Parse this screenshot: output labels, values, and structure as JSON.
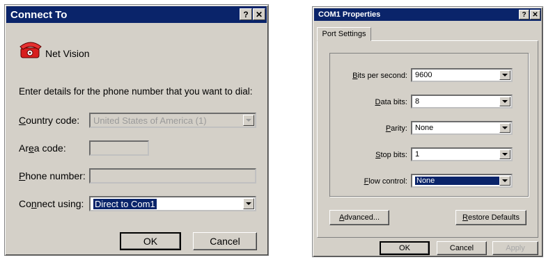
{
  "connect_dialog": {
    "title": "Connect To",
    "help_btn": "?",
    "close_btn": "✕",
    "connection_name": "Net Vision",
    "instruction": "Enter details for the phone number that you want to dial:",
    "country_label_ul": "C",
    "country_label_rest": "ountry code:",
    "country_value": "United States of America (1)",
    "area_label_1": "Ar",
    "area_label_ul": "e",
    "area_label_2": "a code:",
    "area_value": "",
    "phone_label_ul": "P",
    "phone_label_rest": "hone number:",
    "phone_value": "",
    "connect_label_1": "Co",
    "connect_label_ul": "n",
    "connect_label_2": "nect using:",
    "connect_value": "Direct to Com1",
    "ok": "OK",
    "cancel": "Cancel"
  },
  "com_dialog": {
    "title": "COM1 Properties",
    "help_btn": "?",
    "close_btn": "✕",
    "tab": "Port Settings",
    "fields": [
      {
        "pre": "",
        "ul": "B",
        "post": "its per second:",
        "value": "9600"
      },
      {
        "pre": "",
        "ul": "D",
        "post": "ata bits:",
        "value": "8"
      },
      {
        "pre": "",
        "ul": "P",
        "post": "arity:",
        "value": "None"
      },
      {
        "pre": "",
        "ul": "S",
        "post": "top bits:",
        "value": "1"
      },
      {
        "pre": "",
        "ul": "F",
        "post": "low control:",
        "value": "None"
      }
    ],
    "advanced_ul": "A",
    "advanced_rest": "dvanced...",
    "restore_ul": "R",
    "restore_rest": "estore Defaults",
    "ok": "OK",
    "cancel": "Cancel",
    "apply": "Apply"
  },
  "colors": {
    "titlebar": "#0a246a",
    "face": "#d4d0c8",
    "selection": "#0a246a"
  },
  "icons": [
    "phone-icon",
    "help-icon",
    "close-icon",
    "dropdown-arrow-icon"
  ]
}
